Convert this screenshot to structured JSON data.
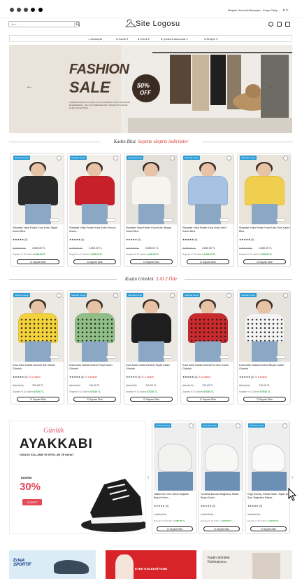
{
  "topbar": {
    "links": [
      "Müşteri Hizmetleri",
      "Siparişim",
      "Kargo Takip",
      "Sepet"
    ],
    "currency": "₺ TL"
  },
  "header": {
    "search_placeholder": "Ara...",
    "logo": "Site Logosu"
  },
  "nav": {
    "items": [
      "Anasayfa",
      "Kadın",
      "Erkek",
      "Çanta & Aksesuar",
      "İletişim"
    ]
  },
  "banner": {
    "title_line1": "FASHION",
    "title_line2": "SALE",
    "discount": "50%",
    "discount_label": "OFF",
    "body": "UNDERSTOOD ANYTHING TO CUSTOMIZE YOUR SHOPPING EXPERIENCE, YOU CAN PREVIEW ANY PRODUCTS FROM OUR COLLECTION.",
    "prev": "←",
    "next": "→"
  },
  "sections": [
    {
      "title": "Kadın Bluz",
      "highlight": "Sepette sürpriz indirimler",
      "products": [
        {
          "badge": "Standart Kargo",
          "title": "Standart Yaka Fularlı Kısa Kollu Siyah Kadın Bluz",
          "rating": "★★★★★",
          "reviews": "(0)",
          "old": "5,750.00 TL",
          "price": "3,660.00 TL",
          "basket_label": "Sepette % 10 indirim",
          "basket_price": "3,300.00 TL",
          "btn": "Sepete Ekle",
          "color": "#2b2b2b",
          "bg": "#f1efec"
        },
        {
          "badge": "Standart Kargo",
          "title": "Standart Yaka Fularlı Kısa Kollu Kırmızı Kadın...",
          "rating": "★★★★★",
          "reviews": "(0)",
          "old": "5,750.00 TL",
          "price": "3,660.00 TL",
          "basket_label": "Sepette % 10 indirim",
          "basket_price": "3,300.00 TL",
          "btn": "Sepete Ekle",
          "color": "#c8202b",
          "bg": "#f2eee9"
        },
        {
          "badge": "Standart Kargo",
          "title": "Standart Yaka Fularlı Kısa Kollu Beyaz Kadın Bluz",
          "rating": "★★★★★",
          "reviews": "(0)",
          "old": "5,750.00 TL",
          "price": "3,660.00 TL",
          "basket_label": "Sepette % 10 indirim",
          "basket_price": "3,300.00 TL",
          "btn": "Sepete Ekle",
          "color": "#f6f4ef",
          "bg": "#e4e0da"
        },
        {
          "badge": "Standart Kargo",
          "title": "Standart Yaka Fularlı Kısa Kollu Mavi Kadın Bluz",
          "rating": "★★★★★",
          "reviews": "(0)",
          "old": "5,750.00 TL",
          "price": "3,660.00 TL",
          "basket_label": "Sepette % 10 indirim",
          "basket_price": "3,300.00 TL",
          "btn": "Sepete Ekle",
          "color": "#a7c3e3",
          "bg": "#eeeae4"
        },
        {
          "badge": "Standart Kargo",
          "title": "Standart Yaka Fularlı Kısa Kollu Sarı Kadın Bluz",
          "rating": "★★★★★",
          "reviews": "(0)",
          "old": "5,750.00 TL",
          "price": "3,660.00 TL",
          "basket_label": "Sepette % 10 indirim",
          "basket_price": "3,300.00 TL",
          "btn": "Sepete Ekle",
          "color": "#f0cf4e",
          "bg": "#e9e3da"
        }
      ]
    },
    {
      "title": "Kadın Gömlek",
      "highlight": "3 Al 2 Öde",
      "products": [
        {
          "badge": "Standart Kargo",
          "title": "Kısa Kollu Nokta Desenli Sarı Kadın Gömlek",
          "rating": "★★★★★",
          "reviews": "(0)",
          "tag": "% 5 indirim",
          "old": "860.00 TL",
          "price": "740.00 TL",
          "basket_label": "Sepette % 10 indirim",
          "basket_price": "675.00 TL",
          "btn": "Sepete Ekle",
          "color": "#f3d23b",
          "bg": "#ece8e2"
        },
        {
          "badge": "Standart Kargo",
          "title": "Kısa Kollu Nokta Desenli Yeşil Kadın Gömlek",
          "rating": "★★★★★",
          "reviews": "(0)",
          "tag": "% 5 indirim",
          "old": "860.00 TL",
          "price": "740.00 TL",
          "basket_label": "Sepette % 10 indirim",
          "basket_price": "675.00 TL",
          "btn": "Sepete Ekle",
          "color": "#8fbf86",
          "bg": "#e9e5df"
        },
        {
          "badge": "Standart Kargo",
          "title": "Kısa Kollu Nokta Desenli Siyah Kadın Gömlek",
          "rating": "★★★★★",
          "reviews": "(0)",
          "tag": "% 5 indirim",
          "old": "860.00 TL",
          "price": "740.00 TL",
          "basket_label": "Sepette % 10 indirim",
          "basket_price": "675.00 TL",
          "btn": "Sepete Ekle",
          "color": "#1e1e1e",
          "bg": "#ebe7e1"
        },
        {
          "badge": "Standart Kargo",
          "title": "Kısa Kollu Nokta Desenli Kırmızı Kadın Gömlek",
          "rating": "★★★★★",
          "reviews": "(0)",
          "tag": "% 5 indirim",
          "old": "860.00 TL",
          "price": "740.00 TL",
          "basket_label": "Sepette % 10 indirim",
          "basket_price": "675.00 TL",
          "btn": "Sepete Ekle",
          "color": "#c82a2e",
          "bg": "#ece9e4"
        },
        {
          "badge": "Standart Kargo",
          "title": "Kısa Kollu Nokta Desenli Beyaz Kadın Gömlek",
          "rating": "★★★★★",
          "reviews": "(0)",
          "tag": "% 5 indirim",
          "old": "860.00 TL",
          "price": "740.00 TL",
          "basket_label": "Sepette % 10 indirim",
          "basket_price": "675.00 TL",
          "btn": "Sepete Ekle",
          "color": "#f4f4f4",
          "bg": "#e6e2dc"
        }
      ]
    }
  ],
  "promo": {
    "script": "Günlük",
    "headline": "AYAKKABI",
    "sub": "GÜNLÜK KULLANIM VE SPOR, ŞIK VE RAHAT",
    "discount_label": "İNDİRİM",
    "discount": "30%",
    "cta": "KEŞFET"
  },
  "shoes": [
    {
      "badge": "Standart Kargo",
      "title": "Hakiki Deri Yeni Sezon Bağcıklı Beyaz Kadın...",
      "rating": "★★★★★",
      "reviews": "(0)",
      "old": "2,350.00 TL",
      "basket_label": "Sepette % 15 indirim",
      "basket_price": "1,990.00 TL",
      "btn": "Sepete Ekle",
      "color": "#f2f2f0"
    },
    {
      "badge": "Standart Kargo",
      "title": "Yuvarlak Burunlu Bağcıksız Rahat Beyaz Kadın...",
      "rating": "★★★★★",
      "reviews": "(0)",
      "old": "2,350.00 TL",
      "basket_label": "Sepette % 15 indirim",
      "basket_price": "1,497.00 TL",
      "btn": "Sepete Ekle",
      "color": "#f7f7f5"
    },
    {
      "badge": "Standart Kargo",
      "title": "Örgü Kumaş, Rahat Taban, Siyah ve Spor Bağcıksız Beyaz...",
      "rating": "★★★★★",
      "reviews": "(0)",
      "old": "2,350.00 TL",
      "basket_label": "Sepette % 15 indirim",
      "basket_price": "1,402.00 TL",
      "btn": "Sepete Ekle",
      "color": "#fafafa"
    }
  ],
  "bottom_banners": [
    {
      "label": "Erkek SPORTİF",
      "bg": "#dcecf6"
    },
    {
      "label": "ETEK KOLEKSİYONU",
      "bg": "#d8232a"
    },
    {
      "label": "Kadın Gömlek Koleksiyonu",
      "bg": "#f1eeea"
    }
  ],
  "colors": {
    "accent": "#d42b2b",
    "badge": "#2b9bd6",
    "green": "#2aa33c"
  }
}
